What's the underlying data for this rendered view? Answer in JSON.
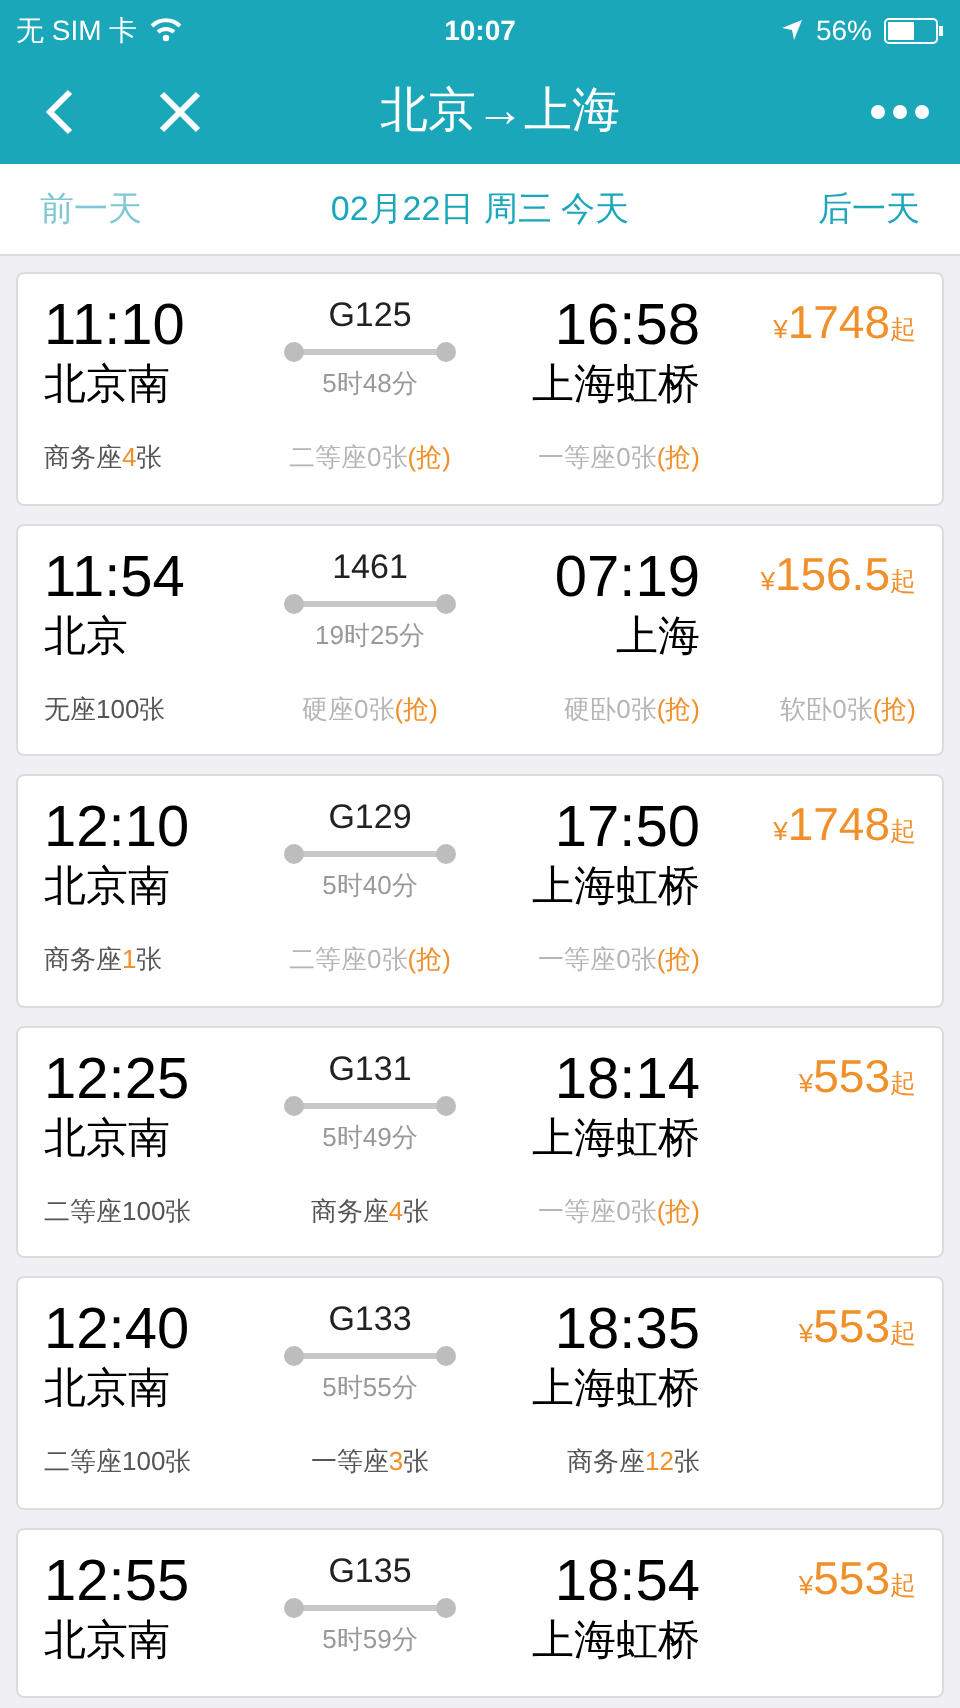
{
  "status_bar": {
    "carrier": "无 SIM 卡",
    "time": "10:07",
    "battery": "56%"
  },
  "nav": {
    "title": "北京→上海"
  },
  "date_bar": {
    "prev": "前一天",
    "date": "02月22日 周三 今天",
    "next": "后一天"
  },
  "trains": [
    {
      "depart_time": "11:10",
      "depart_station": "北京南",
      "code": "G125",
      "duration": "5时48分",
      "arrive_time": "16:58",
      "arrive_station": "上海虹桥",
      "price": {
        "currency": "¥",
        "amount": "1748",
        "suffix": "起"
      },
      "seats": [
        {
          "kind": "few",
          "label": "商务座",
          "count": "4",
          "unit": "张"
        },
        {
          "kind": "sold_out",
          "text": "二等座0张",
          "grab": "(抢)"
        },
        {
          "kind": "sold_out",
          "text": "一等座0张",
          "grab": "(抢)"
        }
      ]
    },
    {
      "depart_time": "11:54",
      "depart_station": "北京",
      "code": "1461",
      "duration": "19时25分",
      "arrive_time": "07:19",
      "arrive_station": "上海",
      "price": {
        "currency": "¥",
        "amount": "156.5",
        "suffix": "起"
      },
      "seats": [
        {
          "kind": "plenty",
          "text": "无座100张"
        },
        {
          "kind": "sold_out",
          "text": "硬座0张",
          "grab": "(抢)"
        },
        {
          "kind": "sold_out",
          "text": "硬卧0张",
          "grab": "(抢)"
        },
        {
          "kind": "sold_out",
          "text": "软卧0张",
          "grab": "(抢)"
        }
      ]
    },
    {
      "depart_time": "12:10",
      "depart_station": "北京南",
      "code": "G129",
      "duration": "5时40分",
      "arrive_time": "17:50",
      "arrive_station": "上海虹桥",
      "price": {
        "currency": "¥",
        "amount": "1748",
        "suffix": "起"
      },
      "seats": [
        {
          "kind": "few",
          "label": "商务座",
          "count": "1",
          "unit": "张"
        },
        {
          "kind": "sold_out",
          "text": "二等座0张",
          "grab": "(抢)"
        },
        {
          "kind": "sold_out",
          "text": "一等座0张",
          "grab": "(抢)"
        }
      ]
    },
    {
      "depart_time": "12:25",
      "depart_station": "北京南",
      "code": "G131",
      "duration": "5时49分",
      "arrive_time": "18:14",
      "arrive_station": "上海虹桥",
      "price": {
        "currency": "¥",
        "amount": "553",
        "suffix": "起"
      },
      "seats": [
        {
          "kind": "plenty",
          "text": "二等座100张"
        },
        {
          "kind": "few",
          "label": "商务座",
          "count": "4",
          "unit": "张"
        },
        {
          "kind": "sold_out",
          "text": "一等座0张",
          "grab": "(抢)"
        }
      ]
    },
    {
      "depart_time": "12:40",
      "depart_station": "北京南",
      "code": "G133",
      "duration": "5时55分",
      "arrive_time": "18:35",
      "arrive_station": "上海虹桥",
      "price": {
        "currency": "¥",
        "amount": "553",
        "suffix": "起"
      },
      "seats": [
        {
          "kind": "plenty",
          "text": "二等座100张"
        },
        {
          "kind": "few",
          "label": "一等座",
          "count": "3",
          "unit": "张"
        },
        {
          "kind": "few",
          "label": "商务座",
          "count": "12",
          "unit": "张"
        }
      ]
    },
    {
      "depart_time": "12:55",
      "depart_station": "北京南",
      "code": "G135",
      "duration": "5时59分",
      "arrive_time": "18:54",
      "arrive_station": "上海虹桥",
      "price": {
        "currency": "¥",
        "amount": "553",
        "suffix": "起"
      }
    }
  ]
}
